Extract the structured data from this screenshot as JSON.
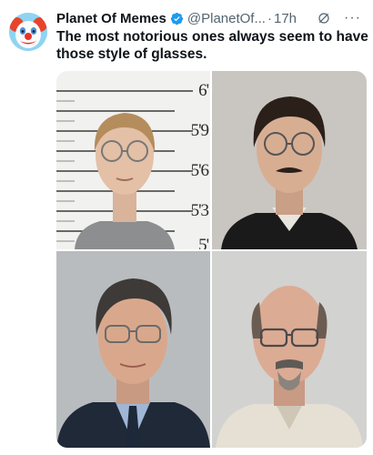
{
  "tweet": {
    "display_name": "Planet Of Memes",
    "handle": "@PlanetOf...",
    "separator": "·",
    "time": "17h",
    "more": "···",
    "text": "The most notorious ones always seem to have those style of glasses."
  },
  "media": {
    "height_chart_labels": [
      "6'",
      "5'9",
      "5'6",
      "5'3",
      "5'"
    ]
  },
  "colors": {
    "verified": "#1d9bf0",
    "text": "#0f1419",
    "secondary": "#536471"
  },
  "icons": {
    "verified": "verified-badge-icon",
    "grok": "grok-icon",
    "more": "more-icon",
    "avatar": "clown-avatar"
  }
}
